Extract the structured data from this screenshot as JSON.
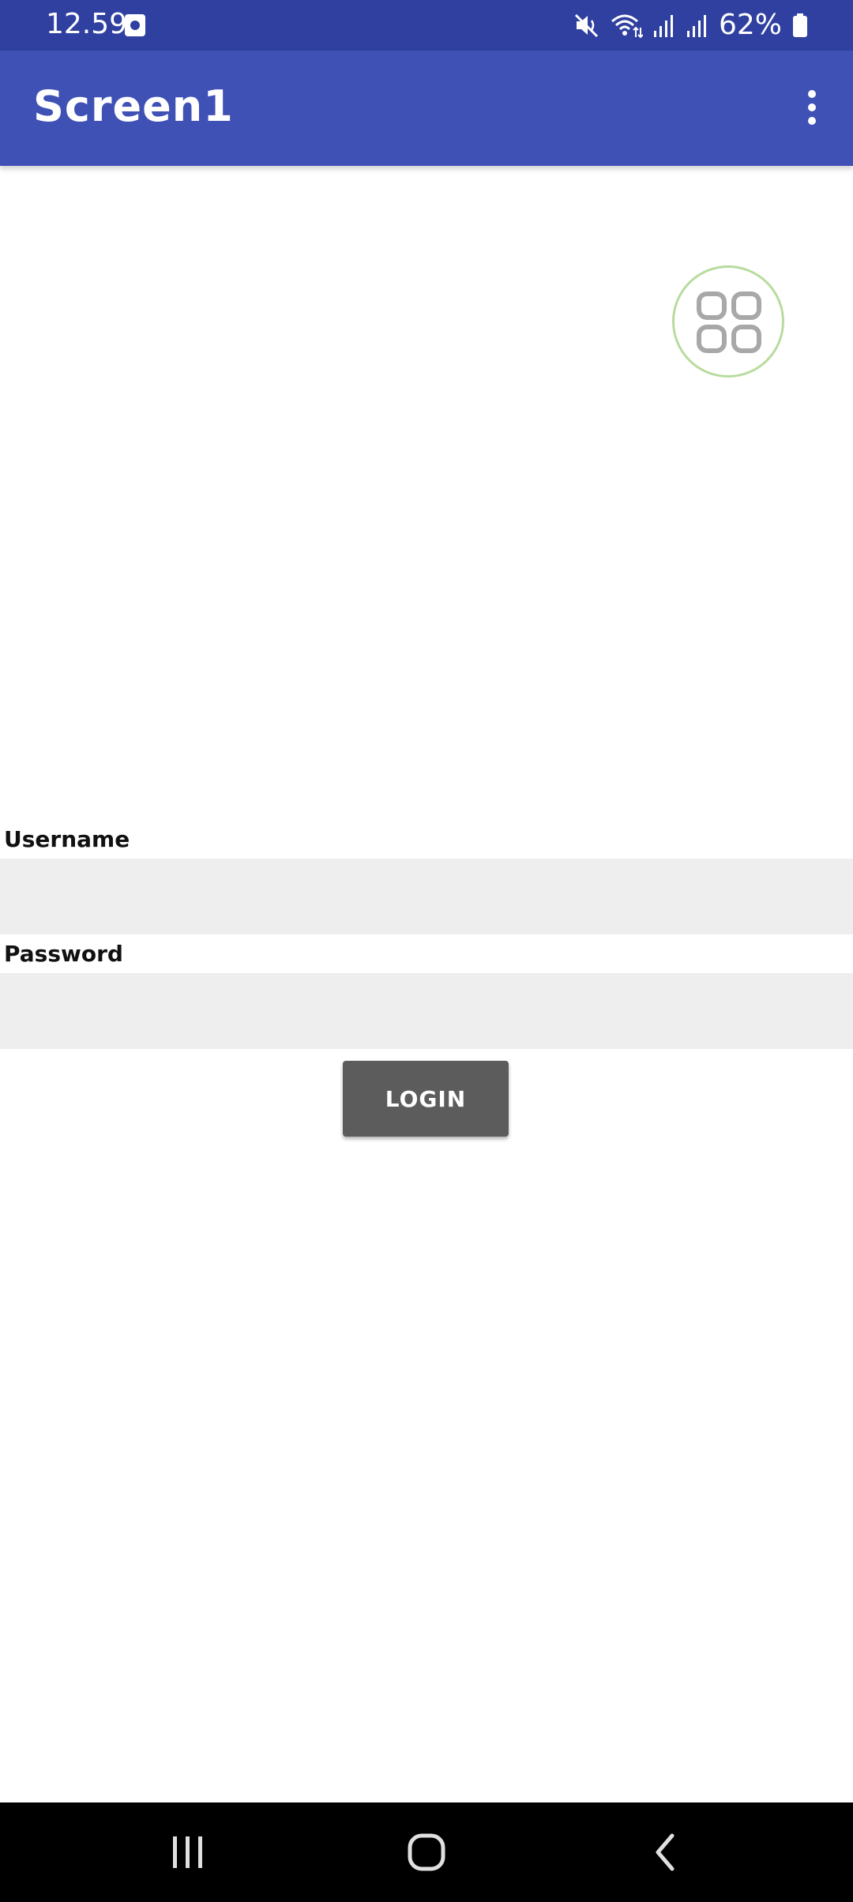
{
  "status_bar": {
    "time": "12.59",
    "battery_percent": "62%",
    "icons": [
      "notification-icon",
      "mute-icon",
      "wifi-icon",
      "signal-icon",
      "signal-icon",
      "battery-icon"
    ]
  },
  "app_bar": {
    "title": "Screen1",
    "menu_icon": "more-vert-icon",
    "color": "#3f51b5"
  },
  "floating_button": {
    "icon": "grid-icon",
    "border_color": "#b7dc9e"
  },
  "form": {
    "username_label": "Username",
    "username_value": "",
    "password_label": "Password",
    "password_value": "",
    "login_label": "LOGIN"
  },
  "nav_bar": {
    "items": [
      "recents-icon",
      "home-icon",
      "back-icon"
    ]
  }
}
